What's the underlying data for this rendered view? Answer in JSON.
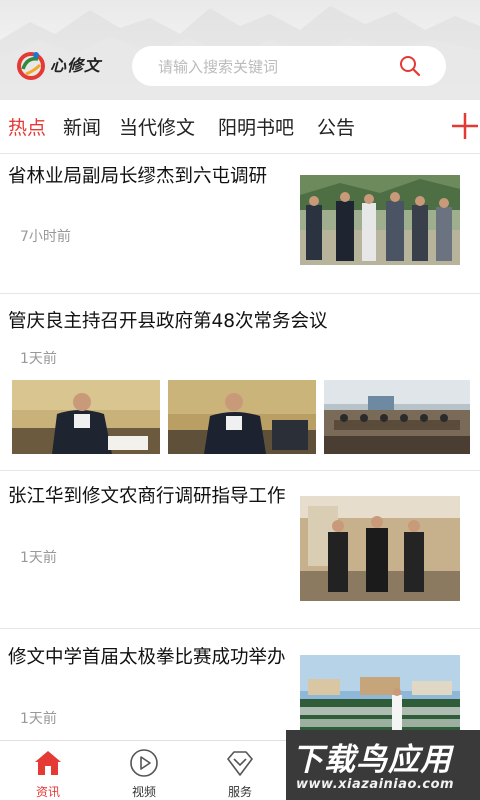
{
  "header": {
    "logo_text": "心修文",
    "search_placeholder": "请输入搜索关键词"
  },
  "tabs": [
    {
      "label": "热点",
      "active": true
    },
    {
      "label": "新闻",
      "active": false
    },
    {
      "label": "当代修文",
      "active": false
    },
    {
      "label": "阳明书吧",
      "active": false
    },
    {
      "label": "公告",
      "active": false
    }
  ],
  "articles": [
    {
      "title": "省林业局副局长缪杰到六屯调研",
      "time": "7小时前"
    },
    {
      "title": "管庆良主持召开县政府第48次常务会议",
      "time": "1天前"
    },
    {
      "title": "张江华到修文农商行调研指导工作",
      "time": "1天前"
    },
    {
      "title": "修文中学首届太极拳比赛成功举办",
      "time": "1天前"
    }
  ],
  "bottom_nav": [
    {
      "label": "资讯",
      "icon": "home-icon",
      "active": true
    },
    {
      "label": "视频",
      "icon": "play-icon",
      "active": false
    },
    {
      "label": "服务",
      "icon": "diamond-icon",
      "active": false
    }
  ],
  "watermark": {
    "title": "下载鸟应用",
    "url": "www.xiazainiao.com"
  },
  "colors": {
    "accent": "#e53935",
    "divider": "#e6e6e6",
    "meta_text": "#999999"
  }
}
